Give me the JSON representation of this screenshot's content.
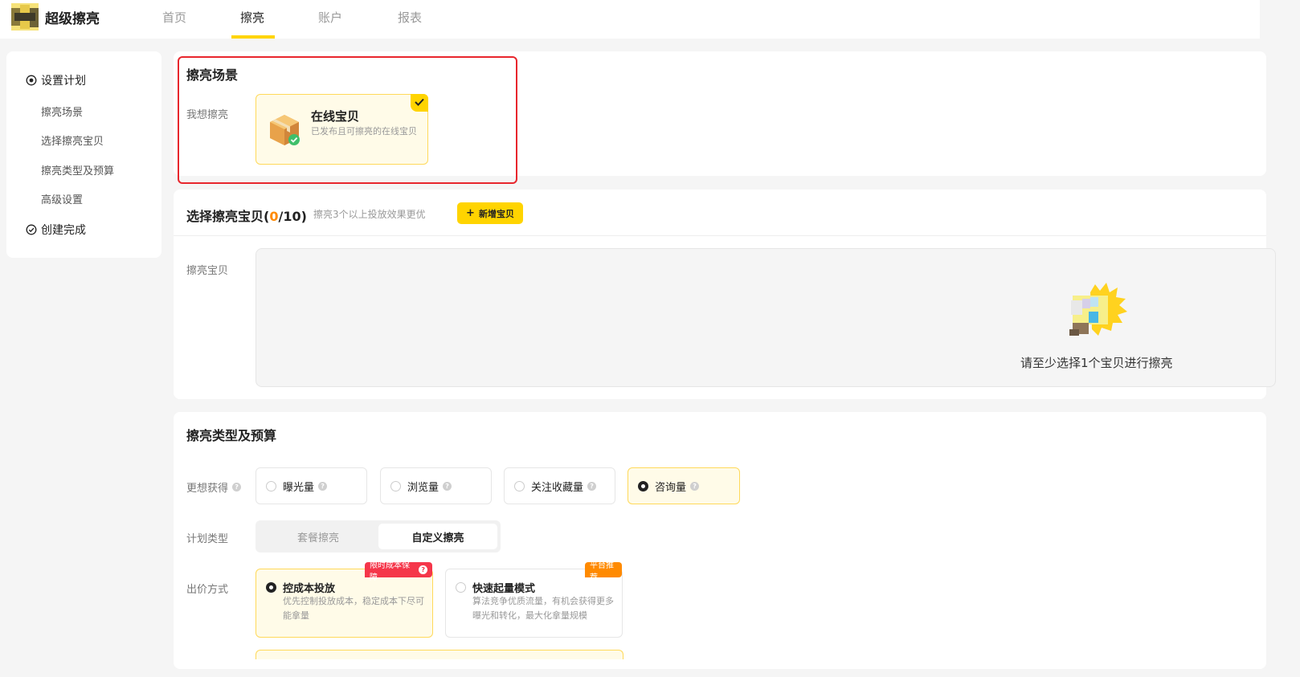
{
  "app": {
    "name": "超级擦亮"
  },
  "nav": {
    "tabs": [
      "首页",
      "擦亮",
      "账户",
      "报表"
    ]
  },
  "sidebar": {
    "step1": "设置计划",
    "subs": [
      "擦亮场景",
      "选择擦亮宝贝",
      "擦亮类型及预算",
      "高级设置"
    ],
    "step2": "创建完成"
  },
  "scene": {
    "title": "擦亮场景",
    "label": "我想擦亮",
    "option_title": "在线宝贝",
    "option_desc": "已发布且可擦亮的在线宝贝"
  },
  "items": {
    "title": "选择擦亮宝贝(",
    "count": "0",
    "max": "/10)",
    "hint": "擦亮3个以上投放效果更优",
    "add_button": "新增宝贝",
    "label": "擦亮宝贝",
    "empty_text": "请至少选择1个宝贝进行擦亮"
  },
  "budget": {
    "title": "擦亮类型及预算",
    "goal_label": "更想获得",
    "goals": [
      "曝光量",
      "浏览量",
      "关注收藏量",
      "咨询量"
    ],
    "plan_label": "计划类型",
    "plan_types": [
      "套餐擦亮",
      "自定义擦亮"
    ],
    "bid_label": "出价方式",
    "bid1_title": "控成本投放",
    "bid1_desc": "优先控制投放成本，稳定成本下尽可能拿量",
    "bid1_tag": "限时成本保障",
    "bid2_title": "快速起量模式",
    "bid2_desc": "算法竞争优质流量，有机会获得更多曝光和转化，最大化拿量规模",
    "bid2_tag": "平台推荐"
  },
  "colors": {
    "accent": "#ffd400",
    "highlight": "#e8262d",
    "tag_red": "#f5364a",
    "tag_orange": "#ff8a00"
  }
}
